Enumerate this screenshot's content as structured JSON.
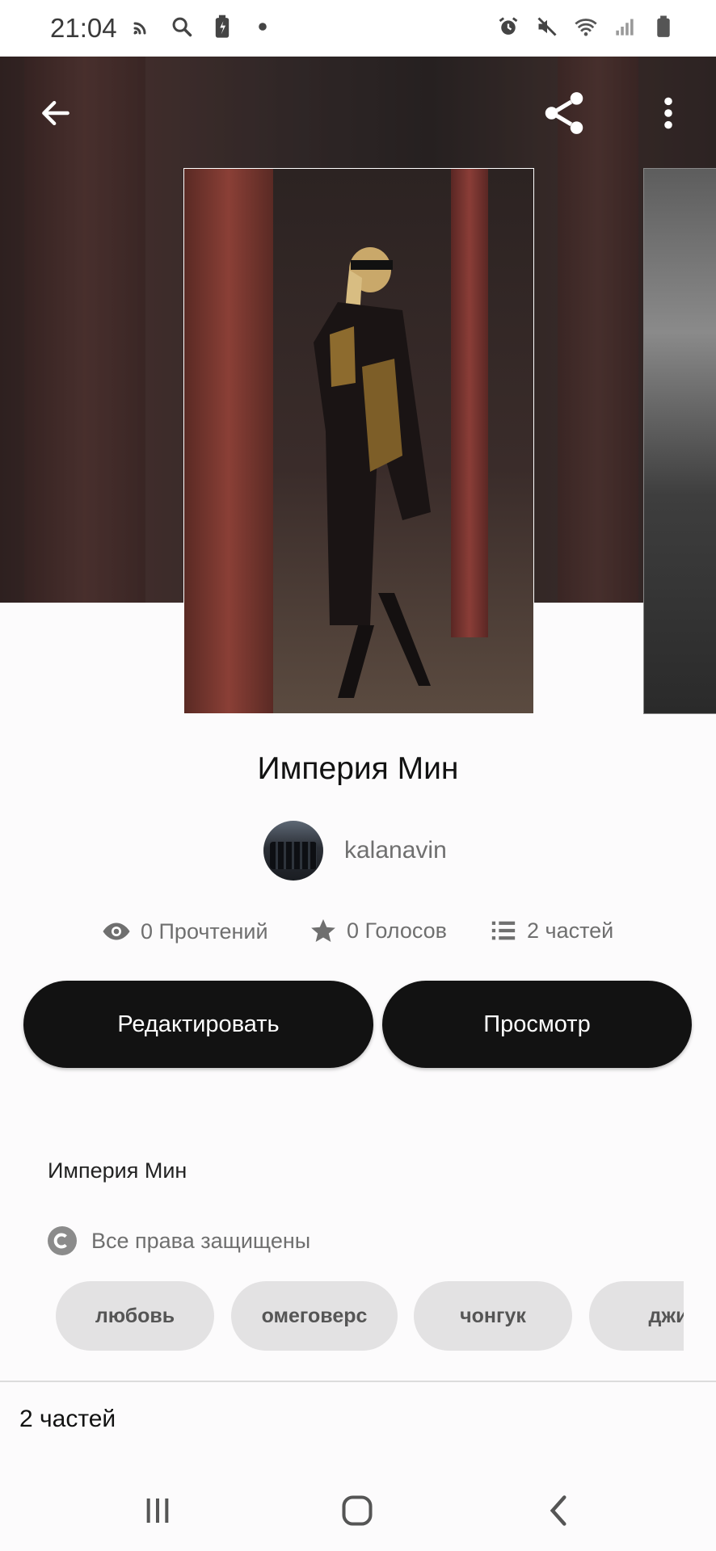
{
  "status_bar": {
    "time": "21:04",
    "left_icons": [
      "cast-icon",
      "search-icon",
      "battery-saver-icon",
      "dot-icon"
    ],
    "right_icons": [
      "alarm-icon",
      "mute-icon",
      "wifi-icon",
      "signal-icon",
      "battery-icon"
    ]
  },
  "toolbar": {
    "back_icon": "arrow-left-icon",
    "share_icon": "share-icon",
    "more_icon": "more-vertical-icon"
  },
  "story": {
    "title": "Империя Мин",
    "author": "kalanavin",
    "description": "Империя Мин",
    "copyright": "Все права защищены"
  },
  "stats": {
    "reads": "0 Прочтений",
    "votes": "0 Голосов",
    "parts": "2 частей"
  },
  "actions": {
    "edit_label": "Редактировать",
    "preview_label": "Просмотр"
  },
  "tags": [
    "любовь",
    "омеговерс",
    "чонгук",
    "джи"
  ],
  "parts_section": {
    "label": "2 частей"
  },
  "colors": {
    "button_bg": "#121212",
    "tag_bg": "#e3e2e3",
    "muted_text": "#6f6f6f"
  }
}
